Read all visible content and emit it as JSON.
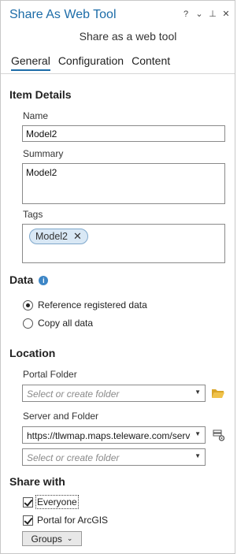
{
  "window": {
    "title": "Share As Web Tool",
    "controls": {
      "help": "?",
      "menu": "⌄",
      "pin": "⊥",
      "close": "✕"
    }
  },
  "subtitle": "Share as a web tool",
  "tabs": [
    {
      "label": "General",
      "active": true
    },
    {
      "label": "Configuration",
      "active": false
    },
    {
      "label": "Content",
      "active": false
    }
  ],
  "item_details": {
    "heading": "Item Details",
    "name_label": "Name",
    "name_value": "Model2",
    "summary_label": "Summary",
    "summary_value": "Model2",
    "tags_label": "Tags",
    "tags": [
      {
        "label": "Model2",
        "remove_icon": "close-icon"
      }
    ]
  },
  "data": {
    "heading": "Data",
    "info_icon": "info-icon",
    "options": [
      {
        "label": "Reference registered data",
        "selected": true
      },
      {
        "label": "Copy all data",
        "selected": false
      }
    ]
  },
  "location": {
    "heading": "Location",
    "portal_folder_label": "Portal Folder",
    "portal_folder_placeholder": "Select or create folder",
    "server_folder_label": "Server and Folder",
    "server_value": "https://tlwmap.maps.teleware.com/server",
    "server_folder_placeholder": "Select or create folder"
  },
  "share_with": {
    "heading": "Share with",
    "options": [
      {
        "label": "Everyone",
        "checked": true
      },
      {
        "label": "Portal for ArcGIS",
        "checked": true
      }
    ],
    "groups_button": "Groups"
  },
  "colors": {
    "accent": "#1c6ca8",
    "info": "#3d86c6",
    "tag_bg": "#d9e8f5",
    "folder": "#e8b739"
  }
}
